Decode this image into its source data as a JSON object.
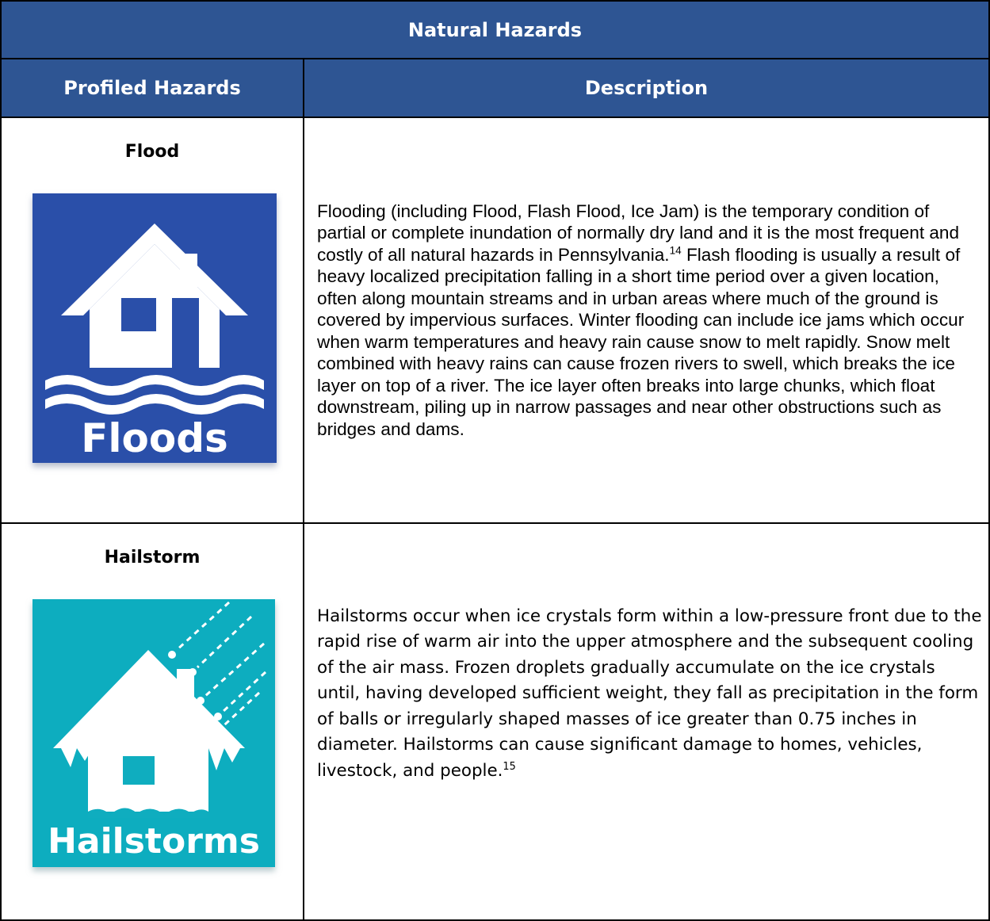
{
  "table": {
    "title": "Natural Hazards",
    "headers": {
      "profiled": "Profiled Hazards",
      "description": "Description"
    },
    "rows": [
      {
        "name": "Flood",
        "icon": "house-flood-icon",
        "icon_label": "Floods",
        "icon_color": "#2a4fa9",
        "description": "Flooding (including Flood, Flash Flood, Ice Jam) is the temporary condition of partial or complete inundation of normally dry land and it is the most frequent and costly of all natural hazards in Pennsylvania.",
        "footnote": "14",
        "description_cont": " Flash flooding is usually a result of heavy localized precipitation falling in a short time period over a given location, often along mountain streams and in urban areas where much of the ground is covered by impervious surfaces. Winter flooding can include ice jams which occur when warm temperatures and heavy rain cause snow to melt rapidly. Snow melt combined with heavy rains can cause frozen rivers to swell, which breaks the ice layer on top of a river. The ice layer often breaks into large chunks, which float downstream, piling up in narrow passages and near other obstructions such as bridges and dams."
      },
      {
        "name": "Hailstorm",
        "icon": "house-hail-icon",
        "icon_label": "Hailstorms",
        "icon_color": "#0fadbf",
        "description": "Hailstorms occur when ice crystals form within a low-pressure front due to the rapid rise of warm air into the upper atmosphere and the subsequent cooling of the air mass. Frozen droplets gradually accumulate on the ice crystals until, having developed sufficient weight, they fall as precipitation in the form of balls or irregularly shaped masses of ice greater than 0.75 inches in diameter. Hailstorms can cause significant damage to homes, vehicles, livestock, and people.",
        "footnote": "15"
      }
    ]
  }
}
